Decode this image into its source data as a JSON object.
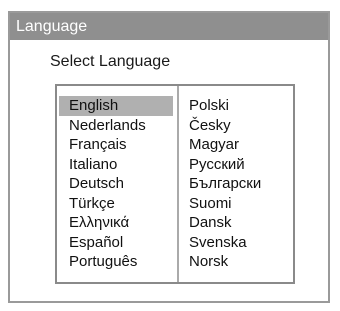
{
  "dialog": {
    "title": "Language",
    "prompt": "Select Language",
    "selected": "English",
    "colors": {
      "titlebar_bg": "#8f8f8f",
      "selection_bg": "#b0b0b0",
      "border": "#9a9a9a"
    },
    "languages_left": [
      "English",
      "Nederlands",
      "Français",
      "Italiano",
      "Deutsch",
      "Türkçe",
      "Ελληνικά",
      "Español",
      "Português"
    ],
    "languages_right": [
      "Polski",
      "Česky",
      "Magyar",
      "Русский",
      "Български",
      "Suomi",
      "Dansk",
      "Svenska",
      "Norsk"
    ]
  }
}
